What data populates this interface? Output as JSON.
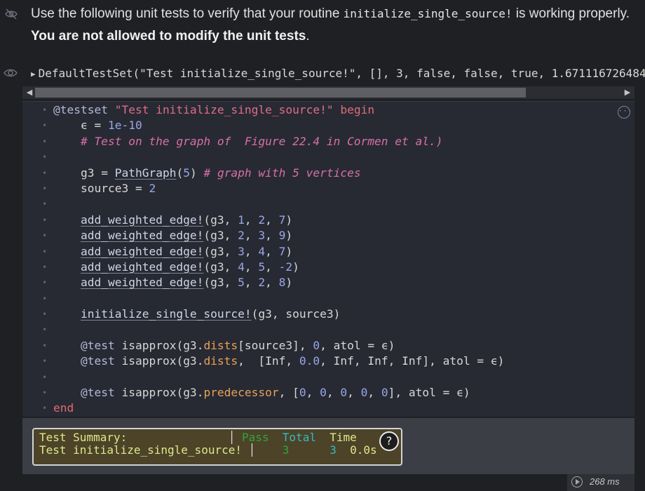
{
  "markdown": {
    "text_1": "Use the following unit tests to verify that your routine ",
    "code": "initialize_single_source!",
    "text_2": " is working properly. ",
    "bold": "You are not allowed to modify the unit tests",
    "text_3": "."
  },
  "output": {
    "text": "DefaultTestSet(\"Test initialize_single_source!\", [], 3, false, false, true, 1.671116726484"
  },
  "code": {
    "testset_macro": "@testset",
    "testset_name": "\"Test initialize_single_source!\"",
    "begin": "begin",
    "end": "end",
    "eps_var": "ϵ",
    "eps_val": "1e-10",
    "comment_1": "# Test on the graph of  Figure 22.4 in Cormen et al.)",
    "g3": "g3",
    "pathgraph": "PathGraph",
    "n_vertices": "5",
    "comment_2": "# graph with 5 vertices",
    "source_var": "source3",
    "source_val": "2",
    "add_fn": "add_weighted_edge!",
    "edges": [
      {
        "u": "1",
        "v": "2",
        "w": "7"
      },
      {
        "u": "2",
        "v": "3",
        "w": "9"
      },
      {
        "u": "3",
        "v": "4",
        "w": "7"
      },
      {
        "u": "4",
        "v": "5",
        "w": "-2"
      },
      {
        "u": "5",
        "v": "2",
        "w": "8"
      }
    ],
    "init_fn": "initialize_single_source!",
    "test_macro": "@test",
    "isapprox": "isapprox",
    "dists": "dists",
    "predecessor": "predecessor",
    "zero": "0",
    "atol": "atol",
    "inf": "Inf",
    "zero_f": "0.0"
  },
  "summary": {
    "header_label": "Test Summary:",
    "pass_label": "Pass",
    "total_label": "Total",
    "time_label": "Time",
    "test_name": "Test initialize_single_source!",
    "pass_value": "3",
    "total_value": "3",
    "time_value": "0.0s",
    "help_symbol": "?"
  },
  "timing": "268 ms"
}
